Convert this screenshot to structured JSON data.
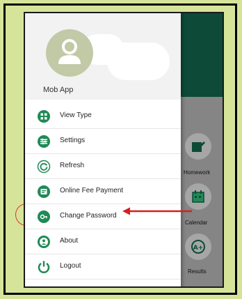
{
  "drawer": {
    "username": "Mob App",
    "items": [
      {
        "label": "View Type",
        "icon": "grid-icon"
      },
      {
        "label": "Settings",
        "icon": "sliders-icon"
      },
      {
        "label": "Refresh",
        "icon": "refresh-icon"
      },
      {
        "label": "Online Fee Payment",
        "icon": "payment-icon"
      },
      {
        "label": "Change Password",
        "icon": "key-icon"
      },
      {
        "label": "About",
        "icon": "about-icon"
      },
      {
        "label": "Logout",
        "icon": "power-icon"
      }
    ]
  },
  "background": {
    "tiles": [
      {
        "label": "Homework"
      },
      {
        "label": "Calendar"
      },
      {
        "label": "Results"
      }
    ]
  },
  "colors": {
    "accent": "#1f8a55",
    "header": "#0d4a38",
    "annotation": "#d81e1e",
    "frame": "#d6e49a"
  }
}
